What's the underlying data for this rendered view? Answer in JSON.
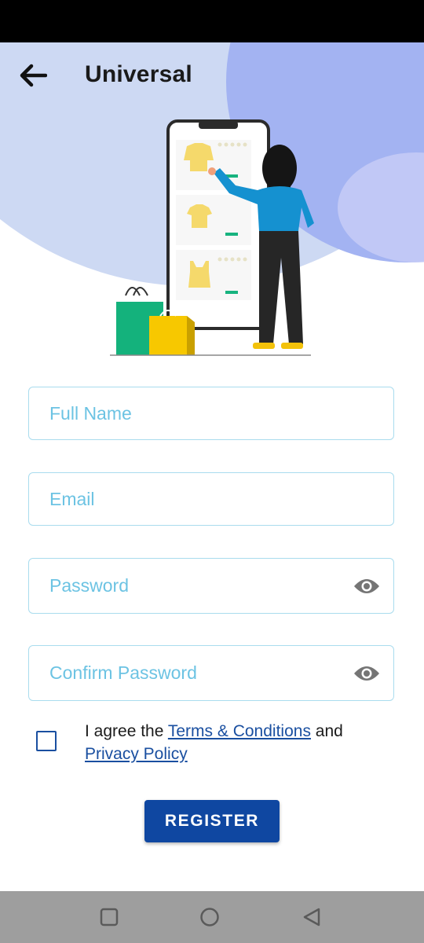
{
  "header": {
    "title": "Universal",
    "back_icon": "arrow-left-icon"
  },
  "form": {
    "full_name": {
      "value": "",
      "placeholder": "Full Name"
    },
    "email": {
      "value": "",
      "placeholder": "Email"
    },
    "password": {
      "value": "",
      "placeholder": "Password",
      "icon": "eye-icon"
    },
    "confirm_password": {
      "value": "",
      "placeholder": "Confirm Password",
      "icon": "eye-icon"
    },
    "agree": {
      "checked": false,
      "prefix": "I agree the ",
      "terms_link": "Terms & Conditions",
      "middle": " and ",
      "privacy_link": "Privacy Policy"
    },
    "register_label": "REGISTER"
  },
  "nav": {
    "recent_icon": "square-icon",
    "home_icon": "circle-icon",
    "back_icon": "triangle-back-icon"
  },
  "colors": {
    "accent": "#0f47a1",
    "field_border": "#a9dcee",
    "placeholder": "#6cc3e3",
    "header_light": "#cdd9f3",
    "header_dark": "#a3b3f2"
  }
}
